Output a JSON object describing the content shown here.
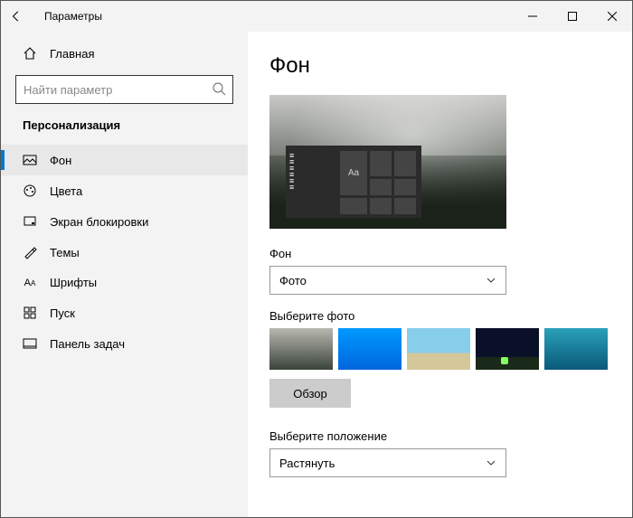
{
  "window": {
    "title": "Параметры"
  },
  "sidebar": {
    "home": "Главная",
    "search_placeholder": "Найти параметр",
    "section": "Персонализация",
    "items": [
      {
        "label": "Фон"
      },
      {
        "label": "Цвета"
      },
      {
        "label": "Экран блокировки"
      },
      {
        "label": "Темы"
      },
      {
        "label": "Шрифты"
      },
      {
        "label": "Пуск"
      },
      {
        "label": "Панель задач"
      }
    ]
  },
  "page": {
    "title": "Фон",
    "preview_sample": "Aa",
    "bg_label": "Фон",
    "bg_value": "Фото",
    "choose_photo_label": "Выберите фото",
    "browse": "Обзор",
    "fit_label": "Выберите положение",
    "fit_value": "Растянуть"
  }
}
